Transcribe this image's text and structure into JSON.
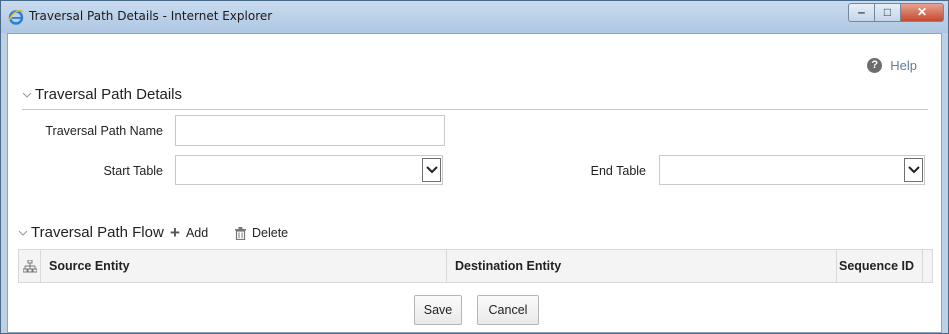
{
  "window": {
    "title": "Traversal Path Details - Internet Explorer",
    "minimize": "‒",
    "maximize": "□",
    "close": "✕"
  },
  "help": {
    "label": "Help",
    "icon": "question-circle-icon"
  },
  "details": {
    "title": "Traversal Path Details",
    "name_label": "Traversal Path Name",
    "name_value": "",
    "start_label": "Start Table",
    "start_value": "",
    "end_label": "End Table",
    "end_value": ""
  },
  "flow": {
    "title": "Traversal Path Flow",
    "add_label": "Add",
    "delete_label": "Delete",
    "columns": [
      "Source Entity",
      "Destination Entity",
      "Sequence ID"
    ]
  },
  "footer": {
    "save_label": "Save",
    "cancel_label": "Cancel"
  }
}
